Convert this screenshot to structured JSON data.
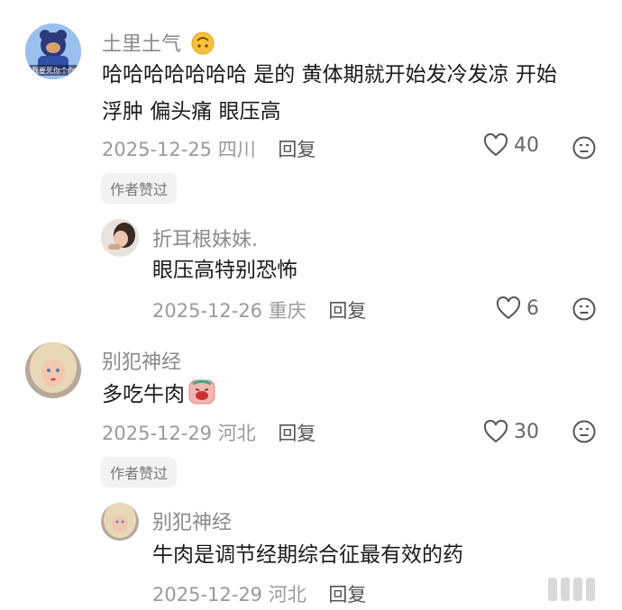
{
  "comments": [
    {
      "username": "土里土气",
      "text_line1": "哈哈哈哈哈哈哈 是的 黄体期就开始发冷发凉 开始",
      "text_line2": "浮肿 偏头痛 眼压高",
      "date": "2025-12-25",
      "location": "四川",
      "reply_label": "回复",
      "likes": "40",
      "badge": "作者赞过"
    },
    {
      "username": "折耳根妹妹.",
      "text": "眼压高特别恐怖",
      "date": "2025-12-26",
      "location": "重庆",
      "reply_label": "回复",
      "likes": "6"
    },
    {
      "username": "别犯神经",
      "text": "多吃牛肉",
      "date": "2025-12-29",
      "location": "河北",
      "reply_label": "回复",
      "likes": "30",
      "badge": "作者赞过"
    },
    {
      "username": "别犯神经",
      "text": "牛肉是调节经期综合征最有效的药",
      "date": "2025-12-29",
      "location": "河北",
      "reply_label": "回复"
    }
  ],
  "avatar_caption": "我要死你个你",
  "icons": {
    "like": "heart-outline-icon",
    "dislike": "meh-face-icon"
  },
  "colors": {
    "meta": "#9a9a9a",
    "username": "#8a8a8a",
    "text": "#1a1a1a"
  }
}
